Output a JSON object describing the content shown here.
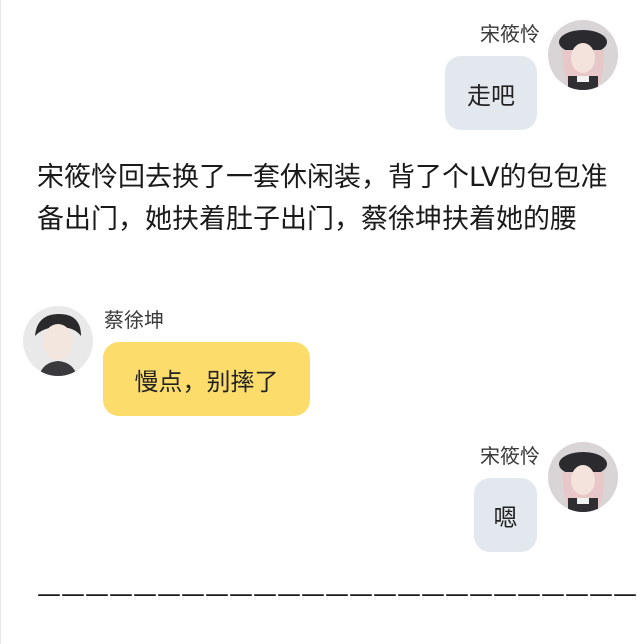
{
  "messages": [
    {
      "sender": "宋筱怜",
      "side": "right",
      "text": "走吧",
      "bubble_color": "#e3e8ef"
    },
    {
      "sender": "蔡徐坤",
      "side": "left",
      "text": "慢点，别摔了",
      "bubble_color": "#fcdd6b"
    },
    {
      "sender": "宋筱怜",
      "side": "right",
      "text": "嗯",
      "bubble_color": "#e3e8ef"
    }
  ],
  "narration": "宋筱怜回去换了一套休闲装，背了个LV的包包准备出门，她扶着肚子出门，蔡徐坤扶着她的腰",
  "separator": "—————————————————————————"
}
